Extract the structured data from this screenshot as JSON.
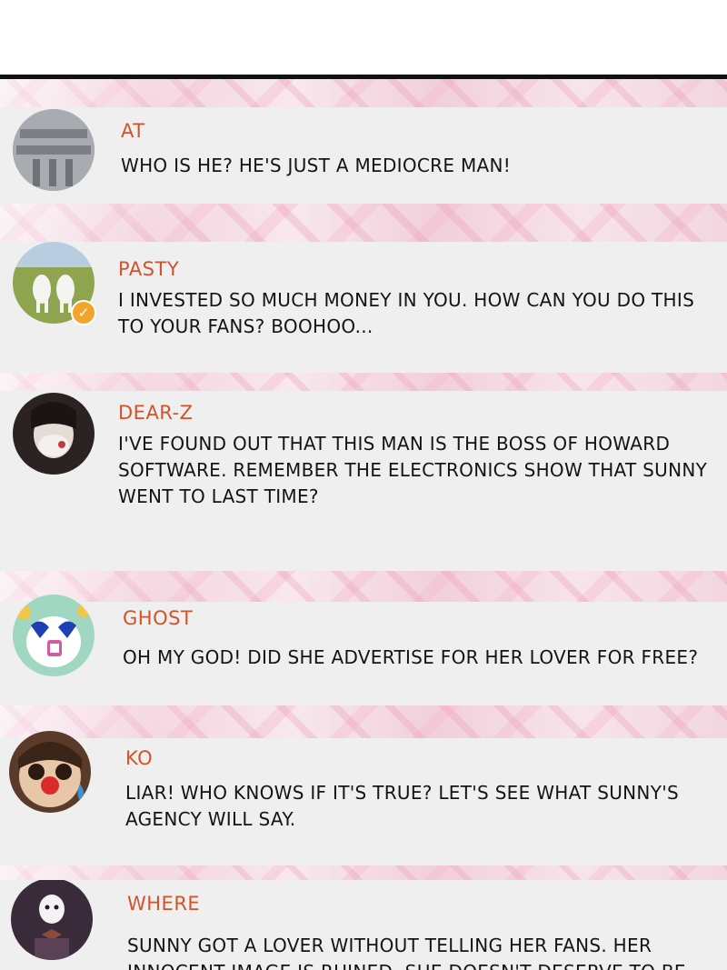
{
  "comments": [
    {
      "name": "AT",
      "message": "WHO IS HE? HE'S JUST A MEDIOCRE MAN!"
    },
    {
      "name": "PASTY",
      "message": "I INVESTED SO MUCH MONEY IN YOU. HOW CAN YOU DO THIS TO YOUR FANS? BOOHOO...",
      "badge": "✓"
    },
    {
      "name": "DEAR-Z",
      "message": "I'VE FOUND OUT THAT THIS MAN IS THE BOSS OF HOWARD SOFTWARE. REMEMBER THE ELECTRONICS SHOW THAT SUNNY WENT TO LAST TIME?"
    },
    {
      "name": "GHOST",
      "message": "OH MY GOD! DID SHE ADVERTISE FOR HER LOVER FOR FREE?"
    },
    {
      "name": "KO",
      "message": "LIAR! WHO KNOWS IF IT'S TRUE? LET'S SEE WHAT SUNNY'S AGENCY WILL SAY."
    },
    {
      "name": "WHERE",
      "message": "SUNNY GOT A LOVER WITHOUT TELLING HER FANS. HER INNOCENT IMAGE IS RUINED. SHE DOESN'T DESERVE TO BE"
    }
  ],
  "colors": {
    "name": "#d0542a",
    "card": "#efefef",
    "text": "#141414",
    "badge": "#f1a52b"
  }
}
